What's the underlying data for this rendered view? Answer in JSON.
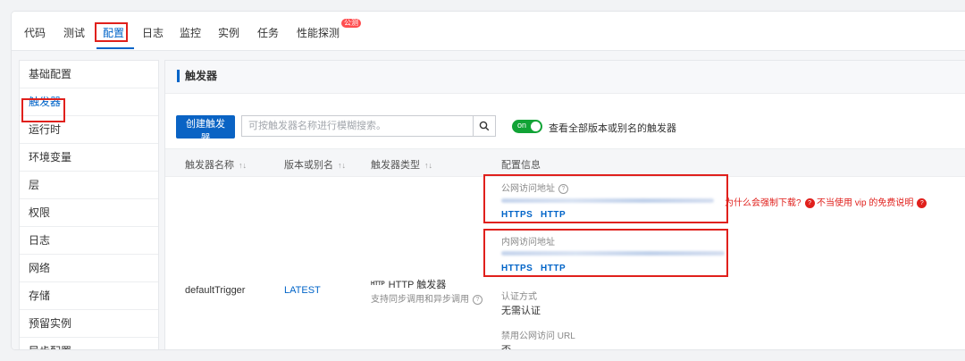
{
  "tabs": [
    {
      "label": "代码"
    },
    {
      "label": "测试"
    },
    {
      "label": "配置"
    },
    {
      "label": "日志"
    },
    {
      "label": "监控"
    },
    {
      "label": "实例"
    },
    {
      "label": "任务"
    },
    {
      "label": "性能探测",
      "badge": "公测"
    }
  ],
  "sidebar": {
    "items": [
      {
        "label": "基础配置"
      },
      {
        "label": "触发器"
      },
      {
        "label": "运行时"
      },
      {
        "label": "环境变量"
      },
      {
        "label": "层"
      },
      {
        "label": "权限"
      },
      {
        "label": "日志"
      },
      {
        "label": "网络"
      },
      {
        "label": "存储"
      },
      {
        "label": "预留实例"
      },
      {
        "label": "异步配置"
      }
    ]
  },
  "panel": {
    "title": "触发器",
    "create_button": "创建触发器",
    "search_placeholder": "可按触发器名称进行模糊搜索。",
    "toggle_state": "on",
    "toggle_label": "查看全部版本或别名的触发器"
  },
  "table": {
    "headers": [
      "触发器名称",
      "版本或别名",
      "触发器类型",
      "配置信息"
    ],
    "row": {
      "name": "defaultTrigger",
      "version": "LATEST",
      "type_mark": "HTTP",
      "type": "HTTP 触发器",
      "type_desc": "支持同步调用和异步调用",
      "public_label": "公网访问地址",
      "public_https": "HTTPS",
      "public_http": "HTTP",
      "warn_download": "为什么会强制下载?",
      "warn_vip": "不当使用 vip 的免费说明",
      "private_label": "内网访问地址",
      "private_https": "HTTPS",
      "private_http": "HTTP",
      "auth_label": "认证方式",
      "auth_value": "无需认证",
      "disable_label": "禁用公网访问 URL",
      "disable_value": "否"
    }
  },
  "colors": {
    "accent": "#0064c8",
    "primary_button": "#0a63c4",
    "toggle_on": "#11a336",
    "highlight_box": "#e0201c"
  },
  "icons": [
    "search-icon",
    "help-icon",
    "sort-icon",
    "http-icon"
  ]
}
